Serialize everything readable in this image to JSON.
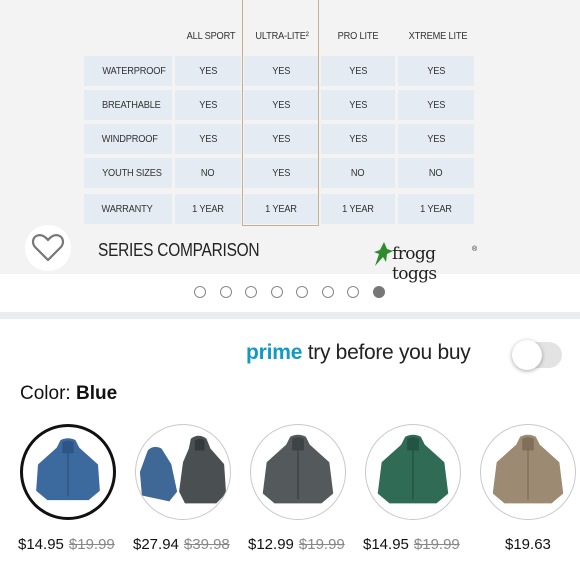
{
  "comparison": {
    "columns": [
      "ALL SPORT",
      "ULTRA-LITE²",
      "PRO LITE",
      "XTREME LITE"
    ],
    "rows": [
      {
        "label": "WATERPROOF",
        "values": [
          "YES",
          "YES",
          "YES",
          "YES"
        ]
      },
      {
        "label": "BREATHABLE",
        "values": [
          "YES",
          "YES",
          "YES",
          "YES"
        ]
      },
      {
        "label": "WINDPROOF",
        "values": [
          "YES",
          "YES",
          "YES",
          "YES"
        ]
      },
      {
        "label": "YOUTH SIZES",
        "values": [
          "NO",
          "YES",
          "NO",
          "NO"
        ]
      },
      {
        "label": "WARRANTY",
        "values": [
          "1 YEAR",
          "1 YEAR",
          "1 YEAR",
          "1 YEAR"
        ]
      }
    ],
    "title": "SERIES COMPARISON",
    "brand": "frogg toggs",
    "brand_mark": "®"
  },
  "carousel": {
    "total": 8,
    "active_index": 7
  },
  "prime": {
    "word": "prime",
    "rest": " try before you buy",
    "toggle_on": false
  },
  "color": {
    "label": "Color: ",
    "value": "Blue"
  },
  "variants": [
    {
      "color": "Blue",
      "price": "$14.95",
      "was": "$19.99",
      "fill": "#3d6a9e",
      "selected": true
    },
    {
      "color": "Blue/Charcoal",
      "price": "$27.94",
      "was": "$39.98",
      "fill": "#3f6896",
      "selected": false
    },
    {
      "color": "Charcoal",
      "price": "$12.99",
      "was": "$19.99",
      "fill": "#545a5c",
      "selected": false
    },
    {
      "color": "Green",
      "price": "$14.95",
      "was": "$19.99",
      "fill": "#2f6b55",
      "selected": false
    },
    {
      "color": "Khaki",
      "price": "$19.63",
      "was": "",
      "fill": "#9c8a72",
      "selected": false
    }
  ]
}
